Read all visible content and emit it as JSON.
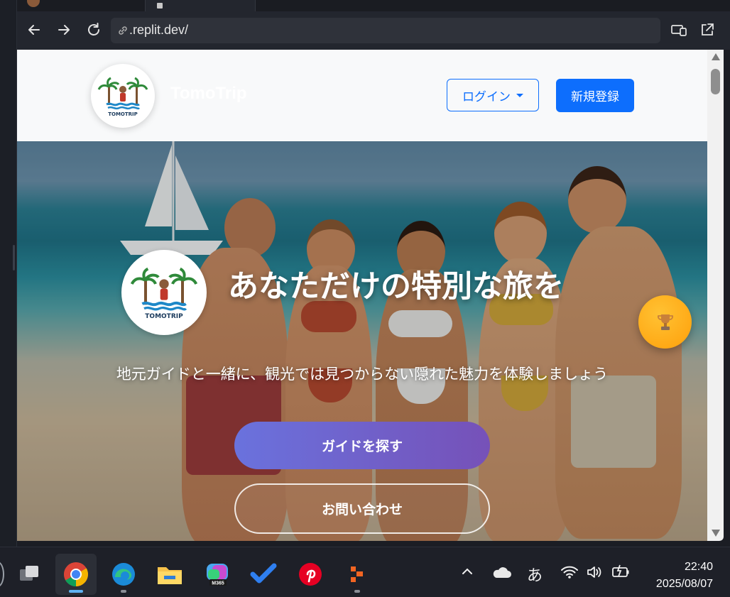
{
  "browser": {
    "url": ".replit.dev/",
    "icons": {
      "back": "back-arrow-icon",
      "forward": "forward-arrow-icon",
      "reload": "reload-icon",
      "link": "link-icon",
      "device": "device-toolbar-icon",
      "open_new": "open-in-new-tab-icon"
    }
  },
  "site": {
    "brand": "TomoTrip",
    "logo_text": "TOMOTRIP",
    "login_label": "ログイン",
    "signup_label": "新規登録",
    "colors": {
      "primary": "#0d6efd",
      "gradient_start": "#6a72dd",
      "gradient_end": "#7651b8",
      "trophy": "#ffa61a"
    }
  },
  "hero": {
    "title": "あなただけの特別な旅を",
    "subtitle": "地元ガイドと一緒に、観光では見つからない隠れた魅力を体験しましょう",
    "primary_cta": "ガイドを探す",
    "secondary_cta": "お問い合わせ",
    "floating_icon": "trophy-icon"
  },
  "taskbar": {
    "apps": [
      {
        "name": "task-view",
        "icon": "task-view-icon"
      },
      {
        "name": "chrome",
        "icon": "chrome-icon",
        "active": true
      },
      {
        "name": "edge",
        "icon": "edge-icon"
      },
      {
        "name": "file-explorer",
        "icon": "folder-icon"
      },
      {
        "name": "m365-copilot",
        "icon": "m365-icon",
        "badge": "M365"
      },
      {
        "name": "todo",
        "icon": "checkmark-icon"
      },
      {
        "name": "pinterest",
        "icon": "pinterest-icon"
      },
      {
        "name": "app",
        "icon": "orange-app-icon"
      }
    ],
    "ime": "あ",
    "time": "22:40",
    "date": "2025/08/07"
  }
}
